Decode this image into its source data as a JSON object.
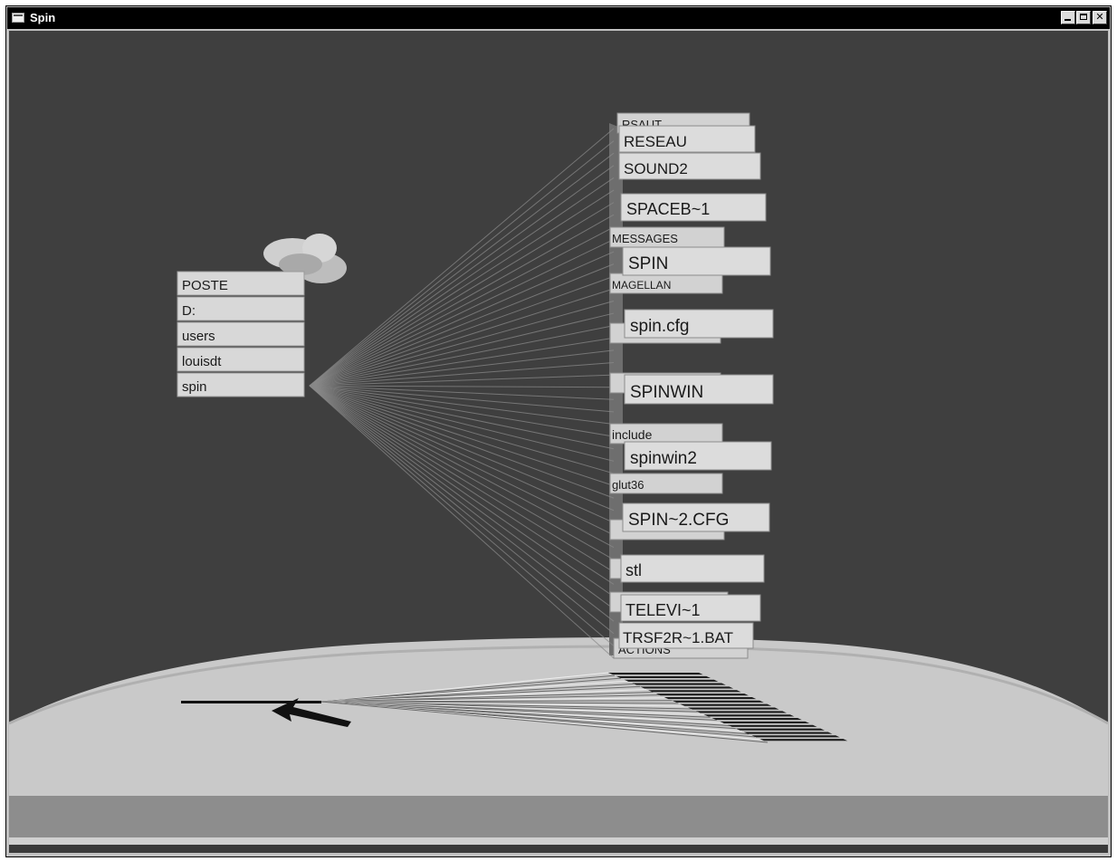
{
  "window": {
    "title": "Spin",
    "controls": {
      "minimize": "minimize",
      "maximize": "maximize",
      "close": "✕"
    }
  },
  "path": [
    "POSTE",
    "D:",
    "users",
    "louisdt",
    "spin"
  ],
  "rear_labels": [
    "RSAUT",
    "MESSAGES",
    "MAGELLAN",
    "include",
    "glut36",
    "ACTIONS"
  ],
  "front_labels": [
    "RESEAU",
    "SOUND2",
    "SPACEB~1",
    "SPIN",
    "spin.cfg",
    "SPINWIN",
    "spinwin2",
    "SPIN~2.CFG",
    "stl",
    "TELEVI~1",
    "TRSF2R~1.BAT"
  ],
  "colors": {
    "background": "#3f3f3f",
    "label_face": "#d8d8d8",
    "floor": "#c9c9c9",
    "floor_band": "#8d8d8d",
    "link_lines": "#8a8a8a"
  },
  "icons": {
    "window": "app-icon",
    "pointer": "arrow-cursor-icon",
    "node": "node-blob-icon"
  }
}
